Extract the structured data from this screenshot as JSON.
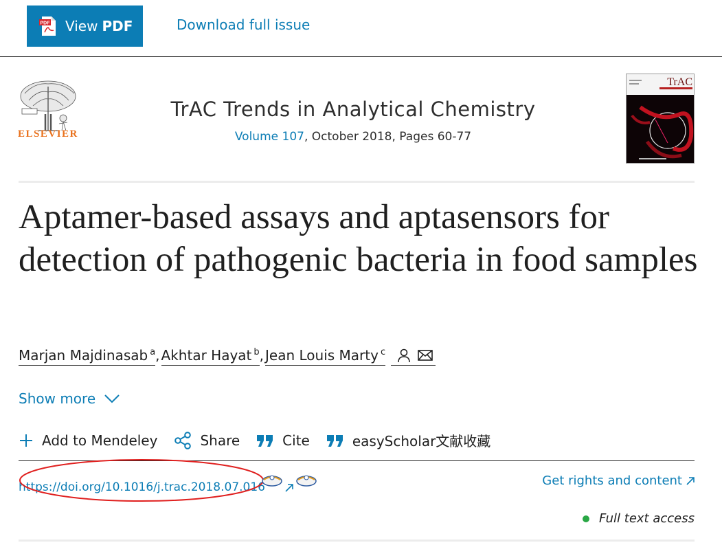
{
  "toolbar": {
    "view_pdf_prefix": "View",
    "view_pdf_bold": "PDF",
    "pdf_icon_text": "PDF",
    "download_label": "Download full issue"
  },
  "journal": {
    "publisher": "ELSEVIER",
    "title": "TrAC Trends in Analytical Chemistry",
    "volume_link": "Volume 107",
    "meta_rest": ", October 2018, Pages 60-77",
    "cover_title": "TrAC"
  },
  "article": {
    "title": "Aptamer-based assays and aptasensors for detection of pathogenic bacteria in food samples",
    "authors": [
      {
        "name": "Marjan Majdinasab",
        "aff": "a"
      },
      {
        "name": "Akhtar Hayat",
        "aff": "b"
      },
      {
        "name": "Jean Louis Marty",
        "aff": "c"
      }
    ],
    "author_separator": ",",
    "show_more": "Show more"
  },
  "actions": {
    "mendeley": "Add to Mendeley",
    "share": "Share",
    "cite": "Cite",
    "easyscholar": "easyScholar文献收藏"
  },
  "doi": {
    "link": "https://doi.org/10.1016/j.trac.2018.07.016",
    "rights": "Get rights and content",
    "access": "Full text access"
  },
  "colors": {
    "link": "#0c7db5",
    "pdf_button": "#0c7db5",
    "publisher": "#e9711c",
    "annotation": "#e0201f",
    "access_dot": "#29a745"
  },
  "icons": [
    "pdf-icon",
    "elsevier-tree-logo",
    "journal-cover",
    "person-icon",
    "envelope-icon",
    "chevron-down-icon",
    "plus-icon",
    "share-icon",
    "quote-icon",
    "sherpa-icon",
    "external-link-icon"
  ]
}
